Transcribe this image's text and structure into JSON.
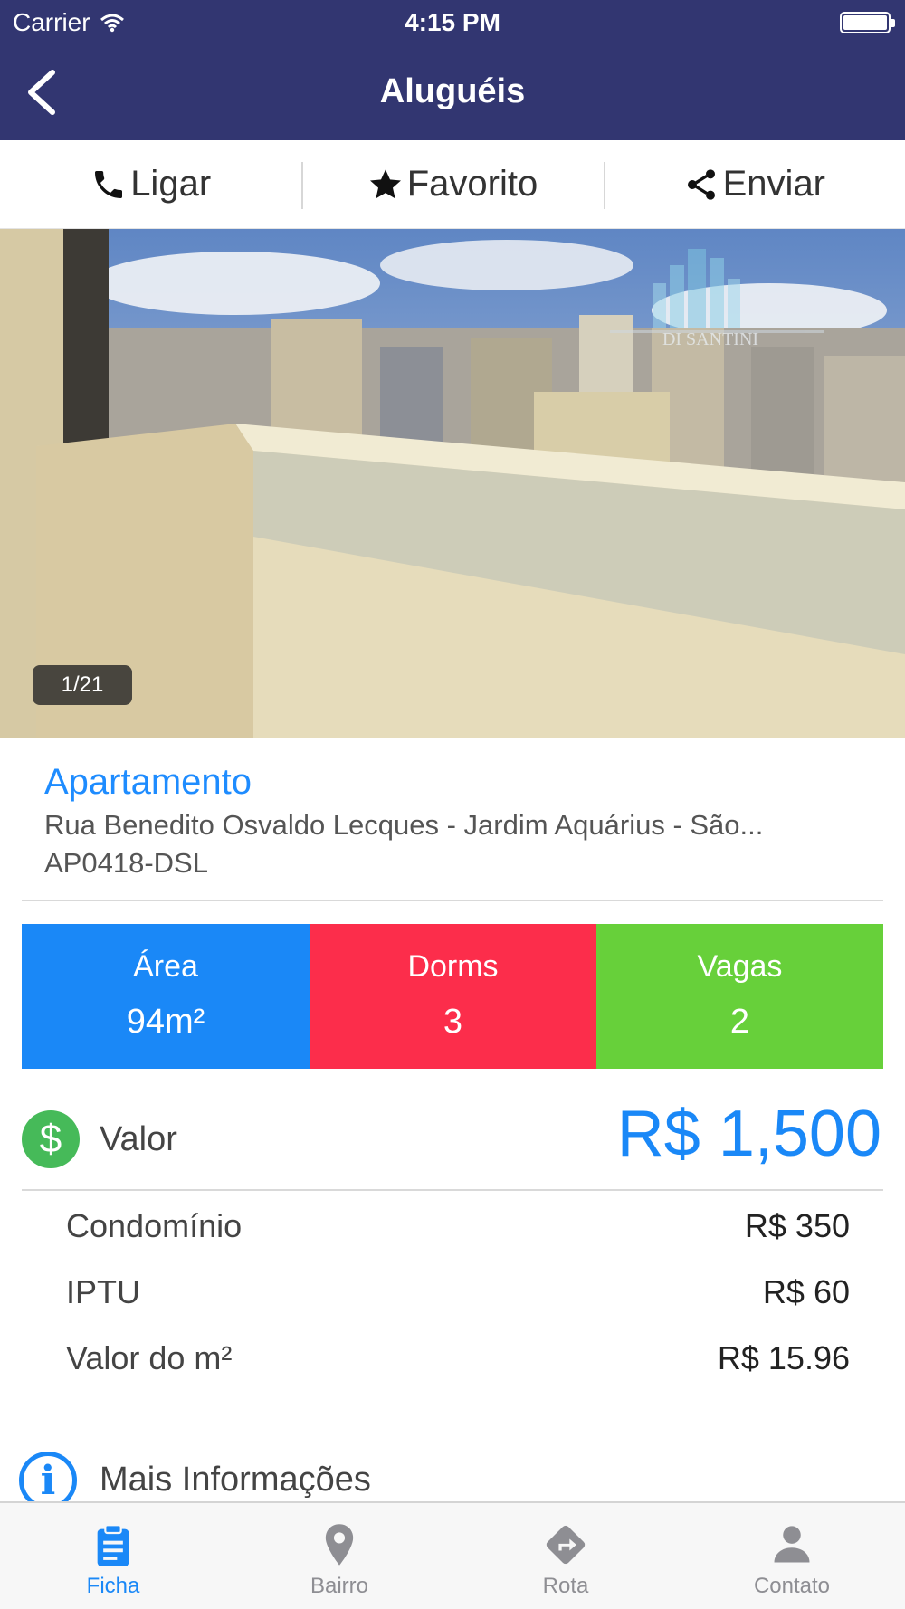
{
  "status": {
    "carrier": "Carrier",
    "time": "4:15 PM"
  },
  "nav": {
    "title": "Aluguéis",
    "back_icon": "chevron-left-icon"
  },
  "actions": [
    {
      "label": "Ligar",
      "icon": "phone-icon"
    },
    {
      "label": "Favorito",
      "icon": "star-icon"
    },
    {
      "label": "Enviar",
      "icon": "share-icon"
    }
  ],
  "photo": {
    "counter": "1/21",
    "watermark": "DI SANTINI"
  },
  "listing": {
    "type": "Apartamento",
    "address": "Rua Benedito Osvaldo Lecques - Jardim Aquárius - São...",
    "code": "AP0418-DSL"
  },
  "tiles": [
    {
      "label": "Área",
      "value": "94m²",
      "color": "#1a88f7"
    },
    {
      "label": "Dorms",
      "value": "3",
      "color": "#fc2d4b"
    },
    {
      "label": "Vagas",
      "value": "2",
      "color": "#67d03a"
    }
  ],
  "valor": {
    "label": "Valor",
    "value": "R$ 1,500",
    "icon": "dollar-icon"
  },
  "costs": [
    {
      "label": "Condomínio",
      "value": "R$ 350"
    },
    {
      "label": "IPTU",
      "value": "R$ 60"
    },
    {
      "label": "Valor do m²",
      "value": "R$ 15.96"
    }
  ],
  "more_info": {
    "label": "Mais Informações",
    "icon": "info-icon"
  },
  "tabs": [
    {
      "label": "Ficha",
      "icon": "clipboard-icon",
      "active": true
    },
    {
      "label": "Bairro",
      "icon": "map-pin-icon",
      "active": false
    },
    {
      "label": "Rota",
      "icon": "route-icon",
      "active": false
    },
    {
      "label": "Contato",
      "icon": "person-icon",
      "active": false
    }
  ],
  "colors": {
    "nav_bg": "#323671",
    "accent": "#1a88f7"
  }
}
